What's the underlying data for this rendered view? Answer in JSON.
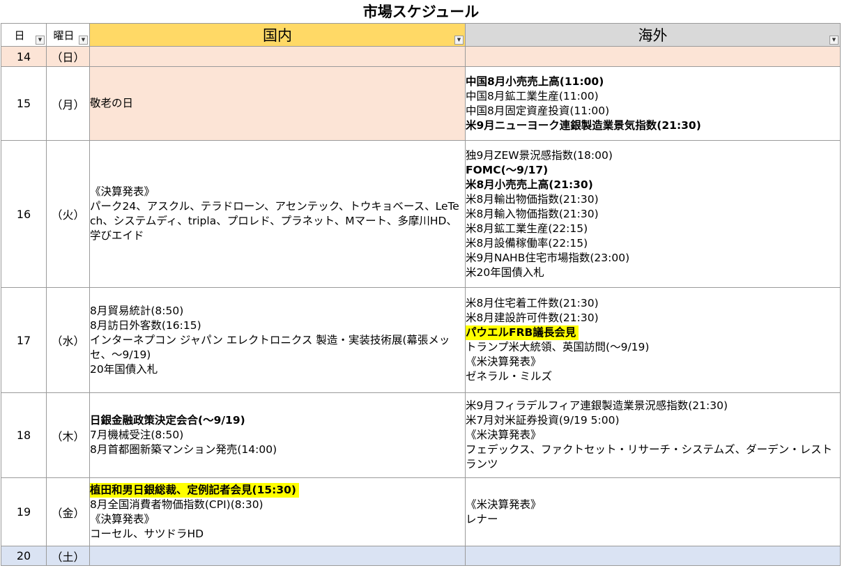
{
  "title": "市場スケジュール",
  "headers": {
    "day": "日",
    "weekday": "曜日",
    "domestic": "国内",
    "overseas": "海外",
    "filter_icon": "filter-dropdown-icon"
  },
  "colors": {
    "domestic_header": "#ffd966",
    "overseas_header": "#d9d9d9",
    "holiday": "#fce4d6",
    "saturday": "#dae3f3",
    "highlight": "#ffff00"
  },
  "rows": [
    {
      "day": "14",
      "weekday": "（日）",
      "domestic": [],
      "overseas": []
    },
    {
      "day": "15",
      "weekday": "（月）",
      "domestic": [
        "敬老の日"
      ],
      "overseas": [
        "中国8月小売売上高(11:00)",
        "中国8月鉱工業生産(11:00)",
        "中国8月固定資産投資(11:00)",
        "米9月ニューヨーク連銀製造業景気指数(21:30)"
      ]
    },
    {
      "day": "16",
      "weekday": "（火）",
      "domestic": [
        "《決算発表》",
        "パーク24、アスクル、テラドローン、アセンテック、トウキョベース、LeTech、システムディ、tripla、プロレド、プラネット、Mマート、多摩川HD、学びエイド"
      ],
      "overseas": [
        "独9月ZEW景況感指数(18:00)",
        "FOMC(～9/17)",
        "米8月小売売上高(21:30)",
        "米8月輸出物価指数(21:30)",
        "米8月輸入物価指数(21:30)",
        "米8月鉱工業生産(22:15)",
        "米8月設備稼働率(22:15)",
        "米9月NAHB住宅市場指数(23:00)",
        "米20年国債入札"
      ]
    },
    {
      "day": "17",
      "weekday": "（水）",
      "domestic": [
        "8月貿易統計(8:50)",
        "8月訪日外客数(16:15)",
        "インターネプコン ジャパン エレクトロニクス 製造・実装技術展(幕張メッセ、～9/19)",
        "20年国債入札"
      ],
      "overseas": [
        "米8月住宅着工件数(21:30)",
        "米8月建設許可件数(21:30)",
        "パウエルFRB議長会見",
        "トランプ米大統領、英国訪問(～9/19)",
        "《米決算発表》",
        "ゼネラル・ミルズ"
      ]
    },
    {
      "day": "18",
      "weekday": "（木）",
      "domestic": [
        "日銀金融政策決定会合(～9/19)",
        "7月機械受注(8:50)",
        "8月首都圏新築マンション発売(14:00)"
      ],
      "overseas": [
        "米9月フィラデルフィア連銀製造業景況感指数(21:30)",
        "米7月対米証券投資(9/19 5:00)",
        "《米決算発表》",
        "フェデックス、ファクトセット・リサーチ・システムズ、ダーデン・レストランツ"
      ]
    },
    {
      "day": "19",
      "weekday": "（金）",
      "domestic": [
        "植田和男日銀総裁、定例記者会見(15:30)",
        "8月全国消費者物価指数(CPI)(8:30)",
        "《決算発表》",
        "コーセル、サツドラHD"
      ],
      "overseas": [
        "《米決算発表》",
        "レナー"
      ]
    },
    {
      "day": "20",
      "weekday": "（土）",
      "domestic": [],
      "overseas": []
    }
  ]
}
